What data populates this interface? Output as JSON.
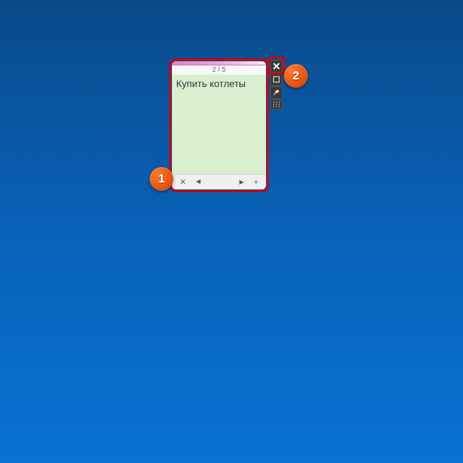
{
  "gadget": {
    "page_indicator": "2 / 5",
    "note_text": "Купить котлеты",
    "footer": {
      "delete_label": "✕",
      "prev_label": "◄",
      "next_label": "►",
      "add_label": "+"
    }
  },
  "side_controls": {
    "close": "close",
    "resize": "resize",
    "settings": "settings",
    "drag": "drag"
  },
  "callouts": {
    "one": "1",
    "two": "2"
  }
}
